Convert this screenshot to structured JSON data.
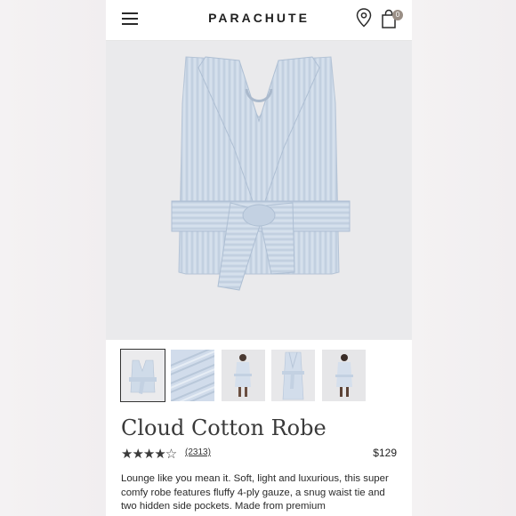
{
  "header": {
    "brand": "PARACHUTE",
    "cart_count": "0",
    "menu_icon": "hamburger-menu-icon",
    "location_icon": "map-pin-icon",
    "cart_icon": "shopping-bag-icon"
  },
  "product": {
    "title": "Cloud Cotton Robe",
    "stars": "★★★★☆",
    "rating": 4.5,
    "review_count": "(2313)",
    "price": "$129",
    "description": "Lounge like you mean it. Soft, light and luxurious, this super comfy robe features fluffy 4-ply gauze, a snug waist tie and two hidden side pockets. Made from premium"
  },
  "gallery": {
    "thumbnails": [
      "robe-folded",
      "robe-fabric-detail",
      "model-front",
      "robe-hanging",
      "model-back"
    ],
    "active_index": 0
  },
  "colors": {
    "robe": "#c9d6e6",
    "background": "#eaeaec",
    "text": "#2a2a2a"
  }
}
